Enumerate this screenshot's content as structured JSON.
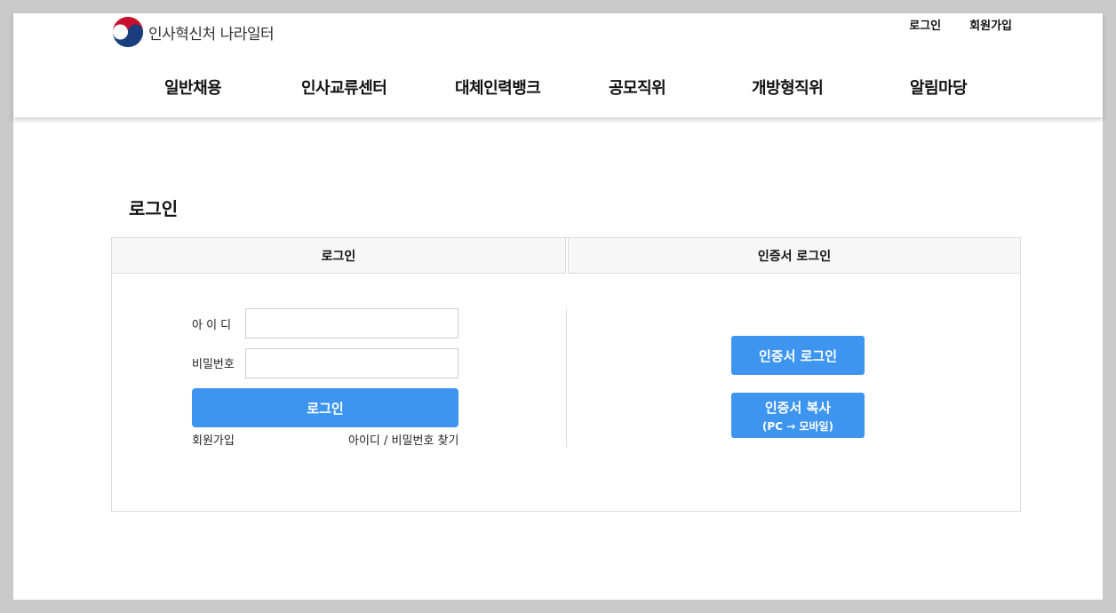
{
  "header": {
    "logo_text": "인사혁신처 나라일터",
    "util_links": {
      "login": "로그인",
      "signup": "회원가입"
    },
    "nav": [
      "일반채용",
      "인사교류센터",
      "대체인력뱅크",
      "공모직위",
      "개방형직위",
      "알림마당"
    ]
  },
  "page": {
    "title": "로그인"
  },
  "tabs": {
    "login": "로그인",
    "cert_login": "인증서 로그인"
  },
  "form": {
    "id_label": "아 이 디",
    "id_value": "",
    "password_label": "비밀번호",
    "password_value": "",
    "login_button": "로그인",
    "signup_link": "회원가입",
    "find_link": "아이디 / 비밀번호 찾기"
  },
  "cert": {
    "login_button": "인증서 로그인",
    "copy_button": "인증서 복사",
    "copy_sub": "(PC → 모바일)"
  },
  "colors": {
    "accent": "#3d95f0",
    "tab_bg": "#f7f7f7",
    "outer_bg": "#c9c9c9"
  },
  "icons": {
    "logo": "korean-government-emblem-icon"
  }
}
